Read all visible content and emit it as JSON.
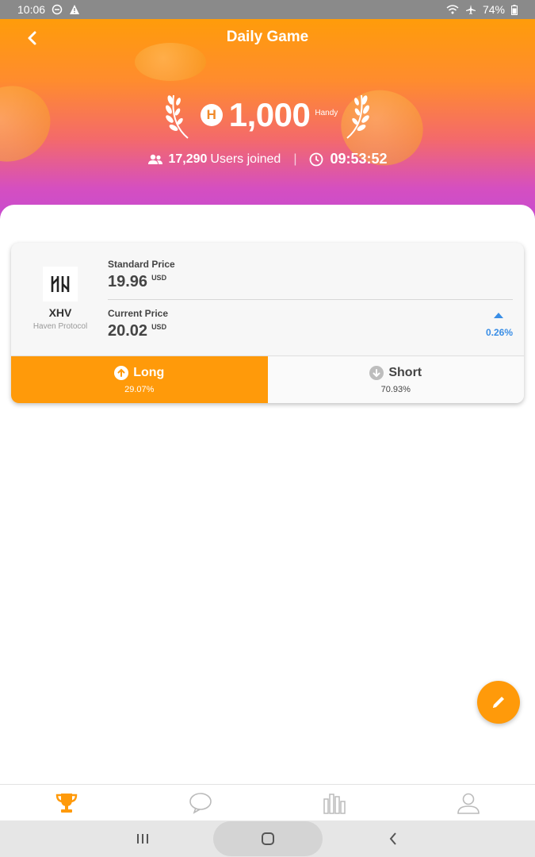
{
  "status_bar": {
    "time": "10:06",
    "battery": "74%"
  },
  "header": {
    "title": "Daily Game",
    "prize_symbol": "H",
    "prize_amount": "1,000",
    "prize_unit": "Handy",
    "users_count": "17,290",
    "users_label": "Users joined",
    "countdown": "09:53:52"
  },
  "card": {
    "coin_symbol": "XHV",
    "coin_name": "Haven Protocol",
    "standard_price_label": "Standard Price",
    "standard_price": "19.96",
    "currency": "USD",
    "current_price_label": "Current Price",
    "current_price": "20.02",
    "change_direction": "up",
    "change_percent": "0.26%",
    "long_label": "Long",
    "long_percent": "29.07%",
    "short_label": "Short",
    "short_percent": "70.93%"
  },
  "bottom_nav": {
    "items": [
      {
        "icon": "trophy-icon",
        "active": true
      },
      {
        "icon": "chat-icon",
        "active": false
      },
      {
        "icon": "chart-icon",
        "active": false
      },
      {
        "icon": "profile-icon",
        "active": false
      }
    ]
  },
  "colors": {
    "accent": "#ff9a0a",
    "gradient_top": "#ff9c0a",
    "gradient_bottom": "#c44ad4",
    "up_color": "#3a8ee6"
  }
}
